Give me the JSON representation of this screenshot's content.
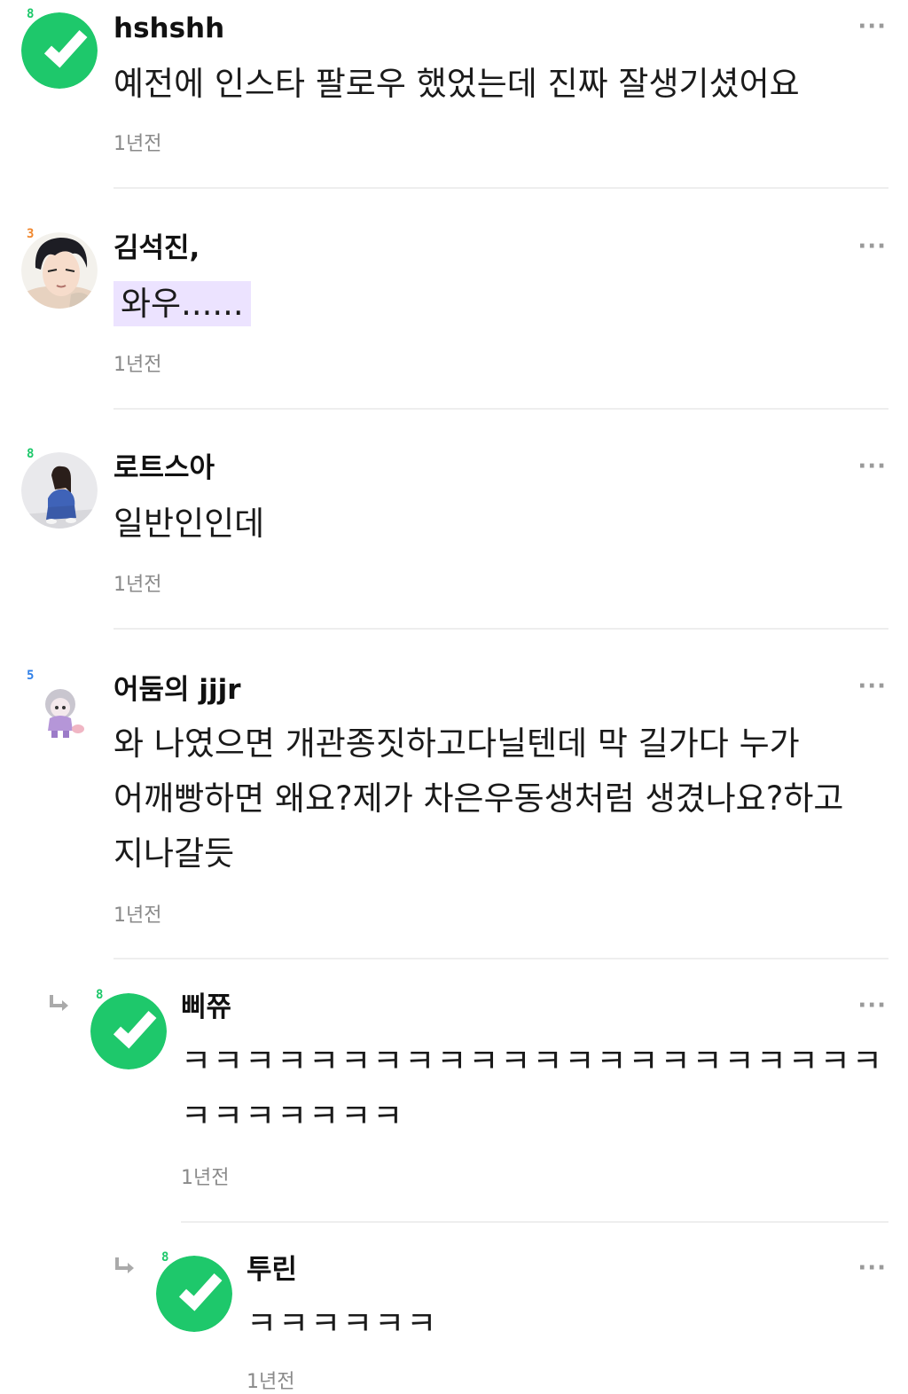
{
  "colors": {
    "accent_green": "#1ec86b",
    "highlight_purple": "#ece3ff",
    "muted_text": "#8a8a8a",
    "divider": "#eeeeee",
    "level_green": "#1ec86b",
    "level_orange": "#f0872d",
    "level_blue": "#2f7fe8"
  },
  "comments": [
    {
      "author": "hshshh",
      "level": "8",
      "avatar": "green-default-avatar",
      "text": "예전에 인스타 팔로우 했었는데 진짜 잘생기셨어요",
      "time": "1년전",
      "more": "···"
    },
    {
      "author": "김석진,",
      "level": "3",
      "avatar": "anime-boy-avatar",
      "text": "와우......",
      "time": "1년전",
      "more": "···"
    },
    {
      "author": "로트스아",
      "level": "8",
      "avatar": "photo-person-avatar",
      "text": "일반인인데",
      "time": "1년전",
      "more": "···"
    },
    {
      "author": "어둠의 jjjr",
      "level": "5",
      "avatar": "character-figure-avatar",
      "text": "와 나였으면 개관종짓하고다닐텐데 막 길가다 누가 어깨빵하면 왜요?제가 차은우동생처럼 생겼나요?하고 지나갈듯",
      "time": "1년전",
      "more": "···"
    }
  ],
  "replies": [
    {
      "author": "삐쮸",
      "level": "8",
      "avatar": "green-default-avatar",
      "text": "ㅋㅋㅋㅋㅋㅋㅋㅋㅋㅋㅋㅋㅋㅋㅋㅋㅋㅋㅋㅋㅋㅋ ㅋㅋㅋㅋㅋㅋㅋ",
      "time": "1년전",
      "more": "···"
    },
    {
      "author": "투린",
      "level": "8",
      "avatar": "green-default-avatar",
      "text": "ㅋㅋㅋㅋㅋㅋ",
      "time": "1년전",
      "more": "···"
    }
  ]
}
